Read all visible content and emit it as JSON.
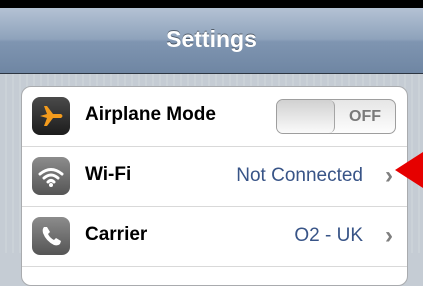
{
  "navbar": {
    "title": "Settings"
  },
  "rows": [
    {
      "label": "Airplane Mode",
      "icon": "airplane-icon",
      "toggle_state": "OFF"
    },
    {
      "label": "Wi-Fi",
      "icon": "wifi-icon",
      "value": "Not Connected"
    },
    {
      "label": "Carrier",
      "icon": "phone-icon",
      "value": "O2 - UK"
    }
  ],
  "colors": {
    "value_text": "#385487",
    "airplane_icon_bg": "#2b2b2b",
    "airplane_glyph": "#f39b1d",
    "annotation_arrow": "#e60000"
  }
}
